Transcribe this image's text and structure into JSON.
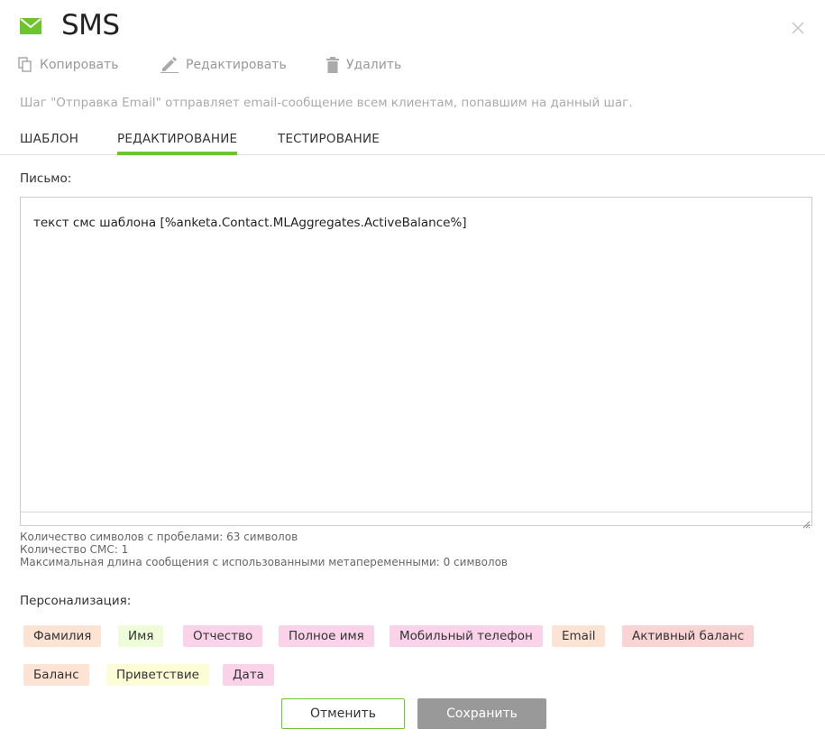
{
  "header": {
    "title": "SMS"
  },
  "toolbar": {
    "copy_label": "Копировать",
    "edit_label": "Редактировать",
    "delete_label": "Удалить"
  },
  "description": "Шаг \"Отправка Email\" отправляет email-сообщение всем клиентам, попавшим на данный шаг.",
  "tabs": [
    {
      "label": "ШАБЛОН"
    },
    {
      "label": "РЕДАКТИРОВАНИЕ"
    },
    {
      "label": "ТЕСТИРОВАНИЕ"
    }
  ],
  "letter": {
    "label": "Письмо:",
    "text": "текст смс шаблона [%anketa.Contact.MLAggregates.ActiveBalance%]"
  },
  "stats": {
    "chars": "Количество символов с пробелами: 63 символов",
    "sms_count": "Количество СМС: 1",
    "max_length": "Максимальная длина сообщения с использованными метапеременными: 0 символов"
  },
  "personalization": {
    "label": "Персонализация:",
    "tags": [
      {
        "label": "Фамилия",
        "color": "#fde3d3"
      },
      {
        "label": "Имя",
        "color": "#eefcd8"
      },
      {
        "label": "Отчество",
        "color": "#fad3ea"
      },
      {
        "label": "Полное имя",
        "color": "#fad3ea"
      },
      {
        "label": "Мобильный телефон",
        "color": "#fad3ea"
      },
      {
        "label": "Email",
        "color": "#fde3d3"
      },
      {
        "label": "Активный баланс",
        "color": "#fad3d5"
      },
      {
        "label": "Баланс",
        "color": "#fde3d3"
      },
      {
        "label": "Приветствие",
        "color": "#fcfcd6"
      },
      {
        "label": "Дата",
        "color": "#fad3ea"
      }
    ]
  },
  "buttons": {
    "cancel_label": "Отменить",
    "save_label": "Сохранить"
  },
  "colors": {
    "accent": "#6cc52a",
    "save_button": "#999999"
  }
}
